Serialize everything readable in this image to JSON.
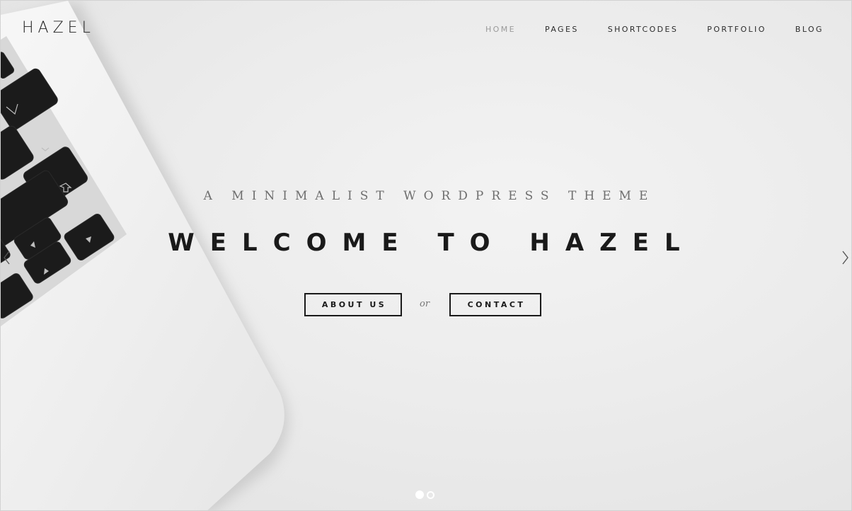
{
  "logo": {
    "text": "HAZEL"
  },
  "nav": {
    "items": [
      {
        "label": "HOME",
        "active": true
      },
      {
        "label": "PAGES",
        "active": false
      },
      {
        "label": "SHORTCODES",
        "active": false
      },
      {
        "label": "PORTFOLIO",
        "active": false
      },
      {
        "label": "BLOG",
        "active": false
      }
    ]
  },
  "hero": {
    "subtitle": "A MINIMALIST WORDPRESS THEME",
    "title": "WELCOME TO HAZEL",
    "about_button": "ABOUT US",
    "separator": "or",
    "contact_button": "CONTACT"
  },
  "slider": {
    "prev_icon": "chevron-left-icon",
    "next_icon": "chevron-right-icon",
    "slide_count": 2,
    "active_slide": 1
  },
  "colors": {
    "text_dark": "#1a1a1a",
    "nav_active": "#9a9a9a",
    "background": "#ececec"
  }
}
